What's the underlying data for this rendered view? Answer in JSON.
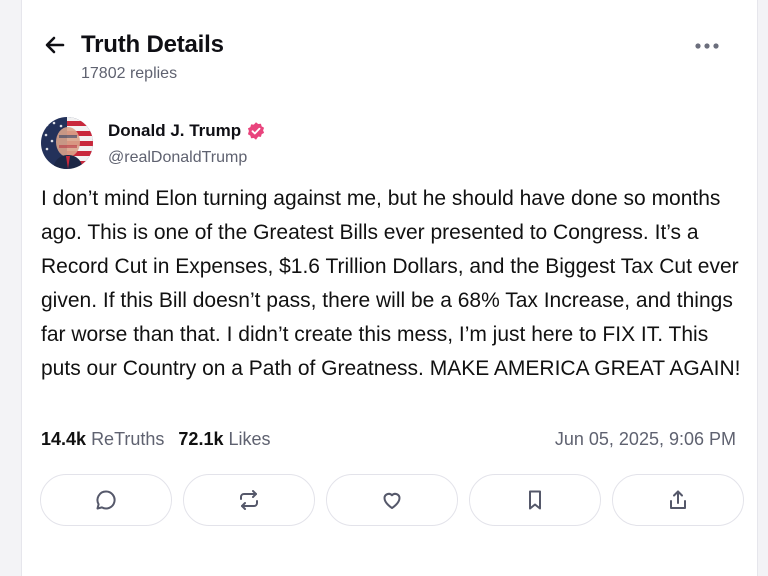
{
  "header": {
    "title": "Truth Details",
    "replies": "17802 replies",
    "back_icon": "arrow-left-icon",
    "more_icon": "more-horizontal-icon"
  },
  "post": {
    "author_name": "Donald J. Trump",
    "handle": "@realDonaldTrump",
    "verified_icon": "verified-badge-icon",
    "verified_color": "#e9447d",
    "body": "I don’t mind Elon turning against me, but he should have done so months ago. This is one of the Greatest Bills ever presented to Congress. It’s a Record Cut in Expenses, $1.6 Trillion Dollars, and the Biggest Tax Cut ever given. If this Bill doesn’t pass, there will be a 68% Tax Increase, and things far worse than that. I didn’t create this mess, I’m just here to FIX IT. This puts our Country on a Path of Greatness. MAKE AMERICA GREAT AGAIN!",
    "retruths_count": "14.4k",
    "retruths_label": "ReTruths",
    "likes_count": "72.1k",
    "likes_label": "Likes",
    "timestamp": "Jun 05, 2025, 9:06 PM"
  },
  "actions": [
    {
      "icon": "reply-icon"
    },
    {
      "icon": "retruth-icon"
    },
    {
      "icon": "like-heart-icon"
    },
    {
      "icon": "bookmark-icon"
    },
    {
      "icon": "share-icon"
    }
  ]
}
